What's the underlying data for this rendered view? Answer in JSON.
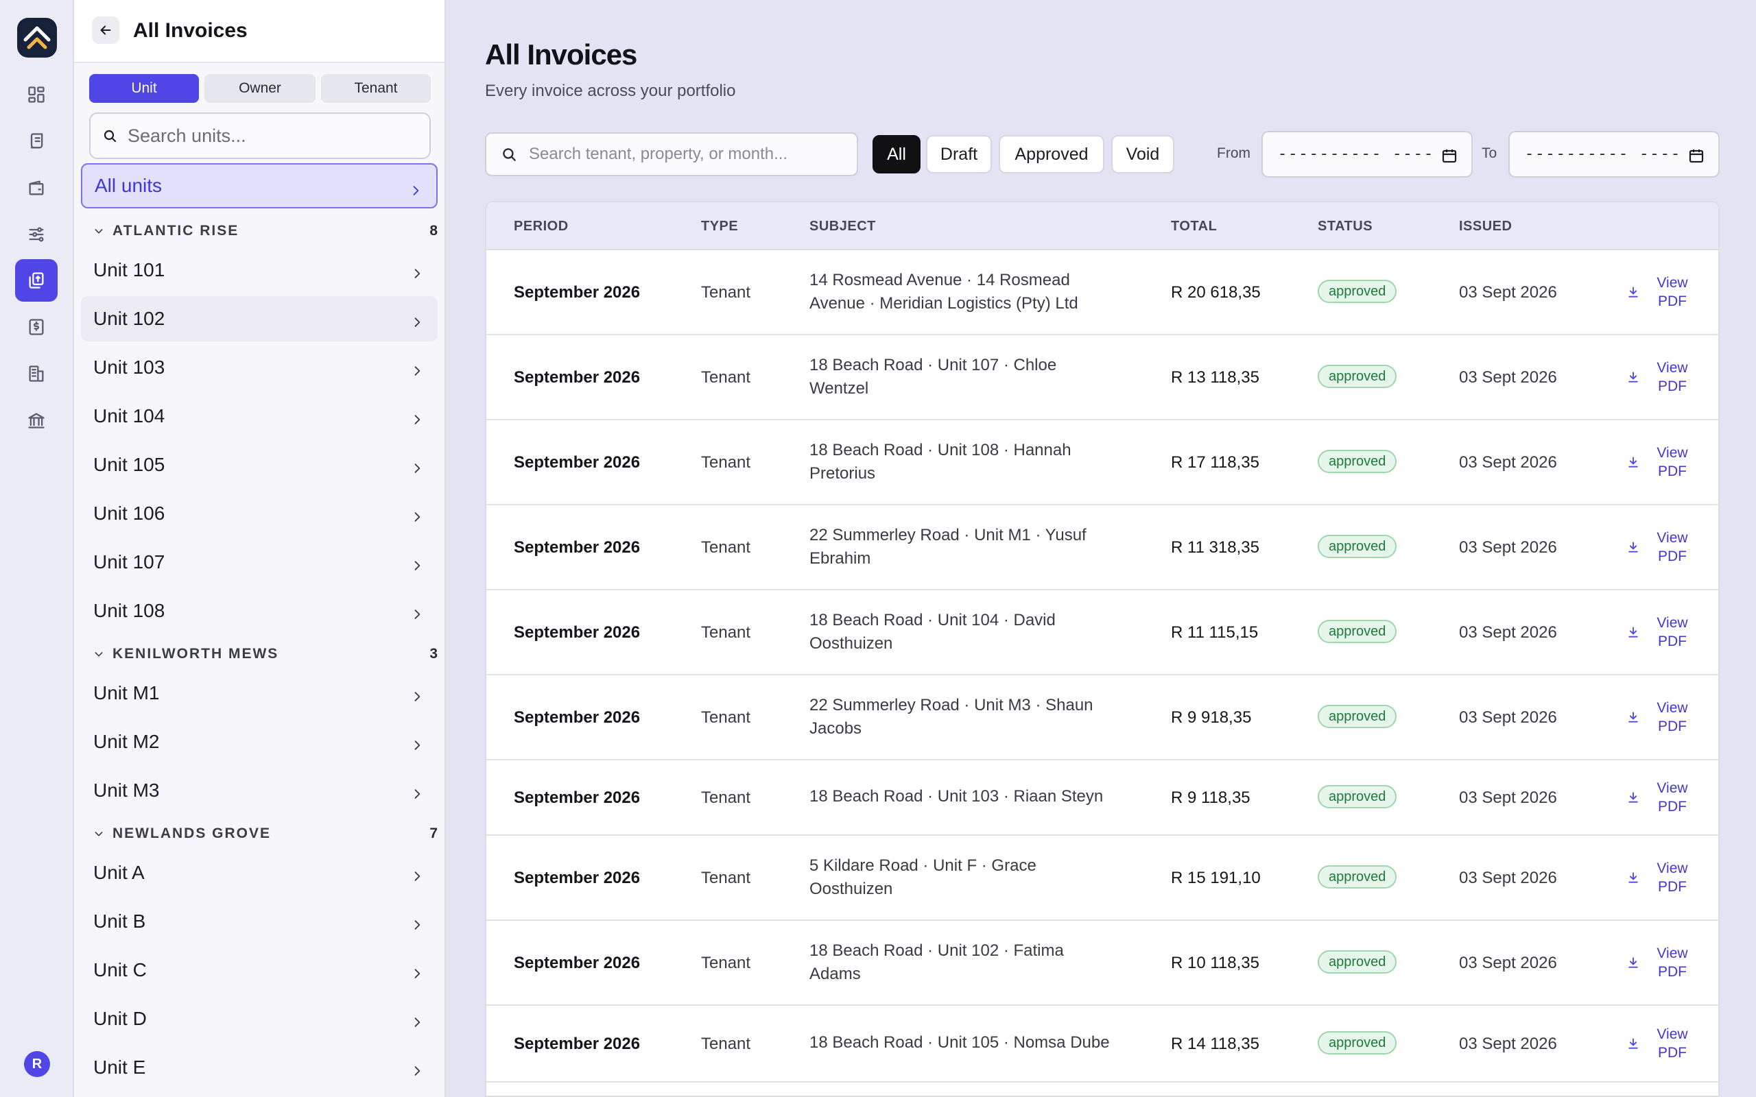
{
  "rail": {
    "icons": [
      "dashboard-icon",
      "ledger-icon",
      "wallet-icon",
      "sliders-icon",
      "invoices-icon",
      "receipt-icon",
      "building-icon",
      "bank-icon"
    ],
    "active": "invoices-icon",
    "avatar_initial": "R",
    "accent": "#4f46e5"
  },
  "panel": {
    "title": "All Invoices",
    "segments": [
      "Unit",
      "Owner",
      "Tenant"
    ],
    "active_segment": "Unit",
    "search_placeholder": "Search units...",
    "all_units_label": "All units",
    "groups": [
      {
        "name": "ATLANTIC RISE",
        "count": "8",
        "units": [
          "Unit 101",
          "Unit 102",
          "Unit 103",
          "Unit 104",
          "Unit 105",
          "Unit 106",
          "Unit 107",
          "Unit 108"
        ]
      },
      {
        "name": "KENILWORTH MEWS",
        "count": "3",
        "units": [
          "Unit M1",
          "Unit M2",
          "Unit M3"
        ]
      },
      {
        "name": "NEWLANDS GROVE",
        "count": "7",
        "units": [
          "Unit A",
          "Unit B",
          "Unit C",
          "Unit D",
          "Unit E"
        ]
      }
    ]
  },
  "main": {
    "title": "All Invoices",
    "subtitle": "Every invoice across your portfolio",
    "search_placeholder": "Search tenant, property, or month...",
    "filters": [
      "All",
      "Draft",
      "Approved",
      "Void"
    ],
    "active_filter": "All",
    "from_label": "From",
    "to_label": "To",
    "date_placeholder": "---------- ----",
    "columns": [
      "PERIOD",
      "TYPE",
      "SUBJECT",
      "TOTAL",
      "STATUS",
      "ISSUED"
    ],
    "view_pdf_label": "View PDF",
    "rows": [
      {
        "period": "September 2026",
        "type": "Tenant",
        "subject": "14 Rosmead Avenue · 14 Rosmead Avenue · Meridian Logistics (Pty) Ltd",
        "total": "R 20 618,35",
        "status": "approved",
        "issued": "03 Sept 2026"
      },
      {
        "period": "September 2026",
        "type": "Tenant",
        "subject": "18 Beach Road · Unit 107 · Chloe Wentzel",
        "total": "R 13 118,35",
        "status": "approved",
        "issued": "03 Sept 2026"
      },
      {
        "period": "September 2026",
        "type": "Tenant",
        "subject": "18 Beach Road · Unit 108 · Hannah Pretorius",
        "total": "R 17 118,35",
        "status": "approved",
        "issued": "03 Sept 2026"
      },
      {
        "period": "September 2026",
        "type": "Tenant",
        "subject": "22 Summerley Road · Unit M1 · Yusuf Ebrahim",
        "total": "R 11 318,35",
        "status": "approved",
        "issued": "03 Sept 2026"
      },
      {
        "period": "September 2026",
        "type": "Tenant",
        "subject": "18 Beach Road · Unit 104 · David Oosthuizen",
        "total": "R 11 115,15",
        "status": "approved",
        "issued": "03 Sept 2026"
      },
      {
        "period": "September 2026",
        "type": "Tenant",
        "subject": "22 Summerley Road · Unit M3 · Shaun Jacobs",
        "total": "R 9 918,35",
        "status": "approved",
        "issued": "03 Sept 2026"
      },
      {
        "period": "September 2026",
        "type": "Tenant",
        "subject": "18 Beach Road · Unit 103 · Riaan Steyn",
        "total": "R 9 118,35",
        "status": "approved",
        "issued": "03 Sept 2026"
      },
      {
        "period": "September 2026",
        "type": "Tenant",
        "subject": "5 Kildare Road · Unit F · Grace Oosthuizen",
        "total": "R 15 191,10",
        "status": "approved",
        "issued": "03 Sept 2026"
      },
      {
        "period": "September 2026",
        "type": "Tenant",
        "subject": "18 Beach Road · Unit 102 · Fatima Adams",
        "total": "R 10 118,35",
        "status": "approved",
        "issued": "03 Sept 2026"
      },
      {
        "period": "September 2026",
        "type": "Tenant",
        "subject": "18 Beach Road · Unit 105 · Nomsa Dube",
        "total": "R 14 118,35",
        "status": "approved",
        "issued": "03 Sept 2026"
      }
    ]
  }
}
